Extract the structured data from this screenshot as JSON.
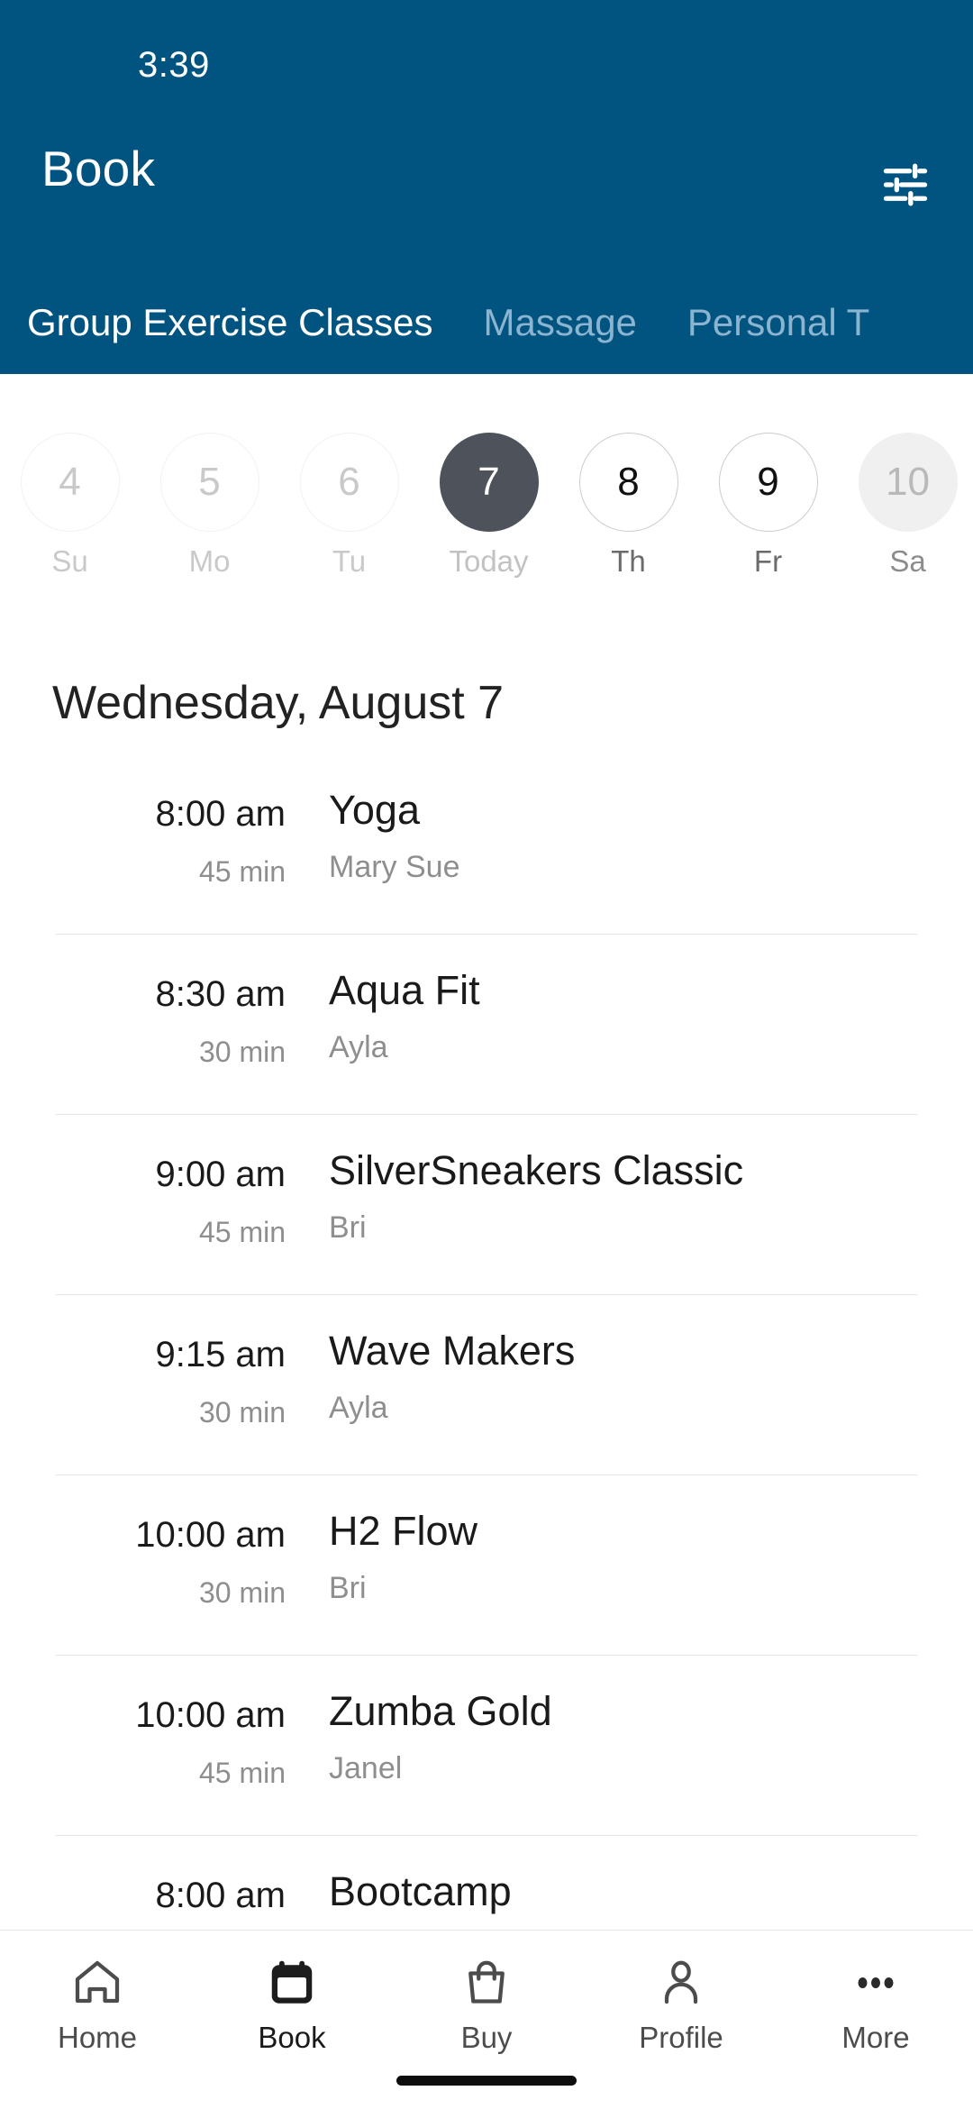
{
  "status_bar": {
    "time": "3:39"
  },
  "header": {
    "title": "Book",
    "filter_icon": "tune-icon",
    "background_color": "#015480",
    "tabs": [
      {
        "label": "Group Exercise Classes",
        "active": true
      },
      {
        "label": "Massage",
        "active": false
      },
      {
        "label": "Personal T",
        "active": false
      }
    ]
  },
  "date_strip": [
    {
      "date": "4",
      "weekday": "Su",
      "state": "past"
    },
    {
      "date": "5",
      "weekday": "Mo",
      "state": "past"
    },
    {
      "date": "6",
      "weekday": "Tu",
      "state": "past"
    },
    {
      "date": "7",
      "weekday": "Today",
      "state": "today"
    },
    {
      "date": "8",
      "weekday": "Th",
      "state": "avail"
    },
    {
      "date": "9",
      "weekday": "Fr",
      "state": "avail"
    },
    {
      "date": "10",
      "weekday": "Sa",
      "state": "muted"
    }
  ],
  "schedule": {
    "day_heading": "Wednesday, August 7",
    "classes": [
      {
        "time": "8:00 am",
        "duration": "45 min",
        "name": "Yoga",
        "instructor": "Mary Sue"
      },
      {
        "time": "8:30 am",
        "duration": "30 min",
        "name": "Aqua Fit",
        "instructor": "Ayla"
      },
      {
        "time": "9:00 am",
        "duration": "45 min",
        "name": "SilverSneakers Classic",
        "instructor": "Bri"
      },
      {
        "time": "9:15 am",
        "duration": "30 min",
        "name": "Wave Makers",
        "instructor": "Ayla"
      },
      {
        "time": "10:00 am",
        "duration": "30 min",
        "name": "H2 Flow",
        "instructor": "Bri"
      },
      {
        "time": "10:00 am",
        "duration": "45 min",
        "name": "Zumba Gold",
        "instructor": "Janel"
      },
      {
        "time": "8:00 am",
        "duration": "",
        "name": "Bootcamp",
        "instructor": ""
      }
    ]
  },
  "bottom_nav": [
    {
      "label": "Home",
      "icon": "home-icon",
      "active": false
    },
    {
      "label": "Book",
      "icon": "calendar-icon",
      "active": true
    },
    {
      "label": "Buy",
      "icon": "bag-icon",
      "active": false
    },
    {
      "label": "Profile",
      "icon": "person-icon",
      "active": false
    },
    {
      "label": "More",
      "icon": "dots-icon",
      "active": false
    }
  ],
  "colors": {
    "brand": "#015480",
    "selected_day": "#4d525b",
    "divider": "#e6e6e6"
  }
}
